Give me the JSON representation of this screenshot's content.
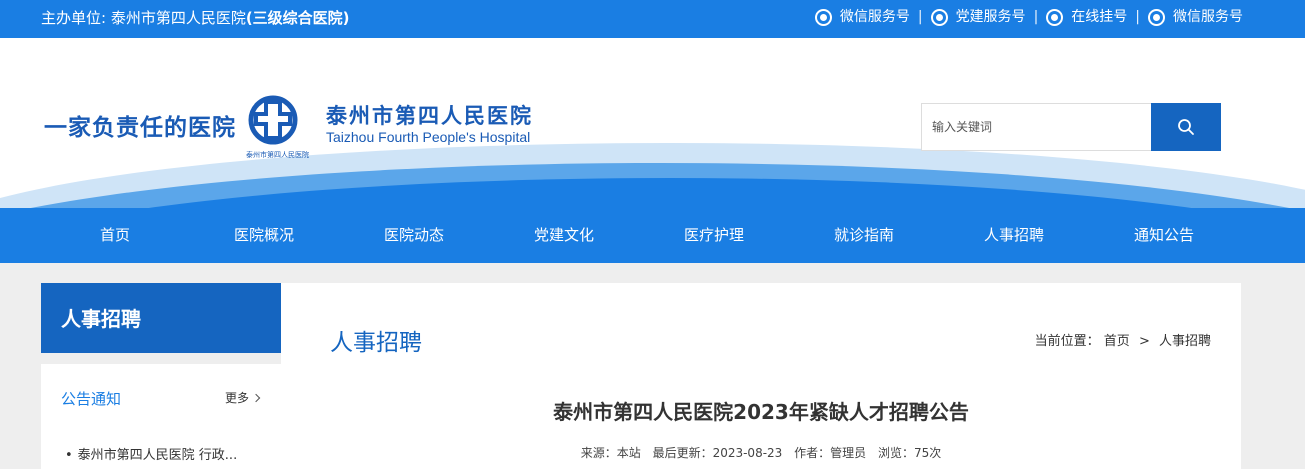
{
  "topbar": {
    "host_label": "主办单位: 泰州市第四人民医院",
    "host_suffix": "(三级综合医院)",
    "links": [
      {
        "label": "微信服务号",
        "icon": "wechat-icon"
      },
      {
        "label": "党建服务号",
        "icon": "party-service-icon"
      },
      {
        "label": "在线挂号",
        "icon": "online-register-icon"
      },
      {
        "label": "微信服务号",
        "icon": "wechat-icon"
      }
    ],
    "separator": "|"
  },
  "header": {
    "slogan": "一家负责任的医院",
    "hospital_name_cn": "泰州市第四人民医院",
    "hospital_name_en": "Taizhou Fourth People's Hospital",
    "logo_subtext": "泰州市第四人民医院",
    "search": {
      "placeholder": "输入关键词",
      "icon": "search-icon"
    }
  },
  "nav": {
    "items": [
      "首页",
      "医院概况",
      "医院动态",
      "党建文化",
      "医疗护理",
      "就诊指南",
      "人事招聘",
      "通知公告"
    ]
  },
  "sidebar": {
    "title": "人事招聘",
    "section_title": "公告通知",
    "more_label": "更多",
    "news": [
      "泰州市第四人民医院 行政..."
    ]
  },
  "main": {
    "page_title": "人事招聘",
    "breadcrumb": {
      "prefix": "当前位置：",
      "home": "首页",
      "gt": ">",
      "current": "人事招聘"
    },
    "article": {
      "title": "泰州市第四人民医院2023年紧缺人才招聘公告",
      "source": "来源：本站",
      "updated": "最后更新：2023-08-23",
      "author": "作者：管理员",
      "views": "浏览：75次"
    }
  },
  "colors": {
    "primary": "#1a7ee3",
    "dark": "#1565c0",
    "background": "#eeeeee"
  }
}
